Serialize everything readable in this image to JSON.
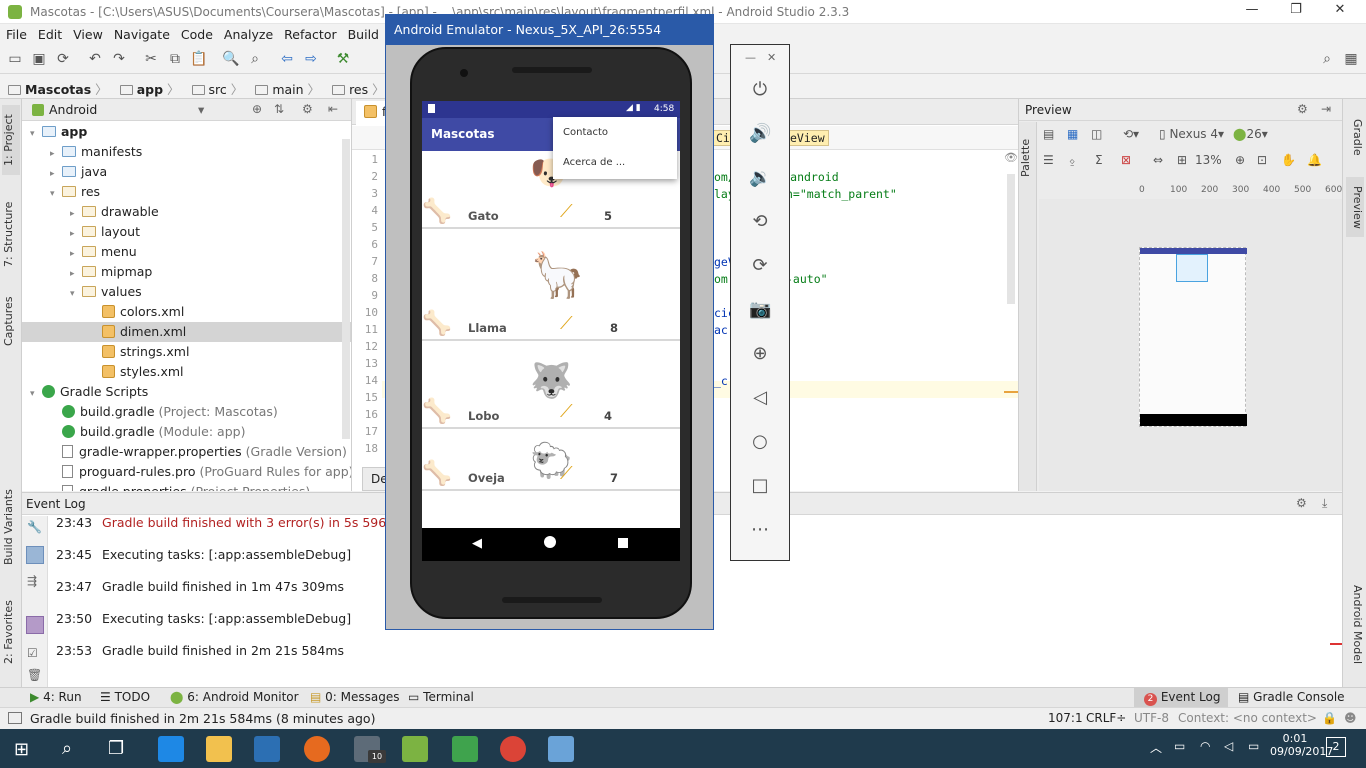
{
  "window": {
    "title": "Mascotas - [C:\\Users\\ASUS\\Documents\\Coursera\\Mascotas] - [app] - ...\\app\\src\\main\\res\\layout\\fragmentperfil.xml - Android Studio 2.3.3"
  },
  "menu": [
    "File",
    "Edit",
    "View",
    "Navigate",
    "Code",
    "Analyze",
    "Refactor",
    "Build",
    "Run"
  ],
  "breadcrumb": [
    "Mascotas",
    "app",
    "src",
    "main",
    "res",
    "layout",
    "f"
  ],
  "project_panel": {
    "view_selector": "Android",
    "tree": [
      {
        "label": "app",
        "extra": "",
        "level": 0,
        "arrow": "▾",
        "icon": "folder-blue"
      },
      {
        "label": "manifests",
        "extra": "",
        "level": 1,
        "arrow": "▸",
        "icon": "folder-blue"
      },
      {
        "label": "java",
        "extra": "",
        "level": 1,
        "arrow": "▸",
        "icon": "folder-blue"
      },
      {
        "label": "res",
        "extra": "",
        "level": 1,
        "arrow": "▾",
        "icon": "folder-res"
      },
      {
        "label": "drawable",
        "extra": "",
        "level": 2,
        "arrow": "▸",
        "icon": "folder-res"
      },
      {
        "label": "layout",
        "extra": "",
        "level": 2,
        "arrow": "▸",
        "icon": "folder-res"
      },
      {
        "label": "menu",
        "extra": "",
        "level": 2,
        "arrow": "▸",
        "icon": "folder-res"
      },
      {
        "label": "mipmap",
        "extra": "",
        "level": 2,
        "arrow": "▸",
        "icon": "folder-res"
      },
      {
        "label": "values",
        "extra": "",
        "level": 2,
        "arrow": "▾",
        "icon": "folder-res"
      },
      {
        "label": "colors.xml",
        "extra": "",
        "level": 3,
        "arrow": "",
        "icon": "xml"
      },
      {
        "label": "dimen.xml",
        "extra": "",
        "level": 3,
        "arrow": "",
        "icon": "xml",
        "selected": true
      },
      {
        "label": "strings.xml",
        "extra": "",
        "level": 3,
        "arrow": "",
        "icon": "xml"
      },
      {
        "label": "styles.xml",
        "extra": "",
        "level": 3,
        "arrow": "",
        "icon": "xml"
      },
      {
        "label": "Gradle Scripts",
        "extra": "",
        "level": 0,
        "arrow": "▾",
        "icon": "gradle"
      },
      {
        "label": "build.gradle",
        "extra": " (Project: Mascotas)",
        "level": 1,
        "arrow": "",
        "icon": "gradle"
      },
      {
        "label": "build.gradle",
        "extra": " (Module: app)",
        "level": 1,
        "arrow": "",
        "icon": "gradle"
      },
      {
        "label": "gradle-wrapper.properties",
        "extra": " (Gradle Version)",
        "level": 1,
        "arrow": "",
        "icon": "doc"
      },
      {
        "label": "proguard-rules.pro",
        "extra": " (ProGuard Rules for app)",
        "level": 1,
        "arrow": "",
        "icon": "doc"
      },
      {
        "label": "gradle.properties",
        "extra": " (Project Properties)",
        "level": 1,
        "arrow": "",
        "icon": "doc"
      }
    ]
  },
  "left_tabs": [
    "1: Project",
    "7: Structure",
    "Captures",
    "Build Variants",
    "2: Favorites"
  ],
  "right_tabs": [
    "Gradle",
    "Preview",
    "Android Model"
  ],
  "editor": {
    "tab": "fr",
    "line_numbers": [
      "1",
      "2",
      "3",
      "4",
      "5",
      "6",
      "7",
      "8",
      "9",
      "10",
      "11",
      "12",
      "13",
      "14",
      "15",
      "16",
      "17",
      "18"
    ],
    "code_fragments": [
      {
        "line": 2,
        "text": "om/apk/res/android"
      },
      {
        "line": 3,
        "text": "lay",
        "text2": "h=\"match_parent\""
      },
      {
        "line": 7,
        "text": "geV"
      },
      {
        "line": 8,
        "text": "om",
        "text2": "-auto\""
      },
      {
        "line": 10,
        "text": "cic"
      },
      {
        "line": 11,
        "text": "ac"
      },
      {
        "line": 14,
        "text": "_c"
      }
    ],
    "header_chip": "Ci",
    "header_chip2": "eView",
    "bottom_tab": "De"
  },
  "preview": {
    "title": "Preview",
    "device": "Nexus 4",
    "api": "26",
    "zoom": "13%",
    "palette_tab": "Palette",
    "ruler_h": [
      "0",
      "100",
      "200",
      "300",
      "400",
      "500",
      "600"
    ],
    "ruler_v": [
      "0",
      "100",
      "200",
      "300",
      "400",
      "500",
      "600",
      "700",
      "800"
    ]
  },
  "event_log": {
    "title": "Event Log",
    "entries": [
      {
        "time": "23:43",
        "text": "Gradle build finished with 3 error(s) in 5s 596ms",
        "error": true
      },
      {
        "time": "23:45",
        "text": "Executing tasks: [:app:assembleDebug]",
        "error": false
      },
      {
        "time": "23:47",
        "text": "Gradle build finished in 1m 47s 309ms",
        "error": false
      },
      {
        "time": "23:50",
        "text": "Executing tasks: [:app:assembleDebug]",
        "error": false
      },
      {
        "time": "23:53",
        "text": "Gradle build finished in 2m 21s 584ms",
        "error": false
      }
    ]
  },
  "tool_tabs": {
    "left": [
      "4: Run",
      "TODO",
      "6: Android Monitor",
      "0: Messages",
      "Terminal"
    ],
    "event_log_badge": "2",
    "event_log": "Event Log",
    "gradle_console": "Gradle Console"
  },
  "status": {
    "message": "Gradle build finished in 2m 21s 584ms (8 minutes ago)",
    "position": "107:1",
    "line_sep": "CRLF÷",
    "encoding": "UTF-8",
    "context": "Context: <no context>"
  },
  "emulator": {
    "title": "Android Emulator - Nexus_5X_API_26:5554",
    "time": "4:58",
    "app_title": "Mascotas",
    "menu": [
      "Contacto",
      "Acerca de ..."
    ],
    "pets": [
      {
        "name": "Gato",
        "rating": "5",
        "emoji": "🐶"
      },
      {
        "name": "Llama",
        "rating": "8",
        "emoji": "🦙"
      },
      {
        "name": "Lobo",
        "rating": "4",
        "emoji": "🐺"
      },
      {
        "name": "Oveja",
        "rating": "7",
        "emoji": "🐑"
      }
    ]
  },
  "taskbar": {
    "time": "0:01",
    "date": "09/09/2017",
    "notifications": "2",
    "mail_badge": "10"
  },
  "colors": {
    "accent": "#3f4aa5",
    "status_dark": "#2d3590",
    "error": "#b22222",
    "taskbar": "#1f3a4c"
  }
}
